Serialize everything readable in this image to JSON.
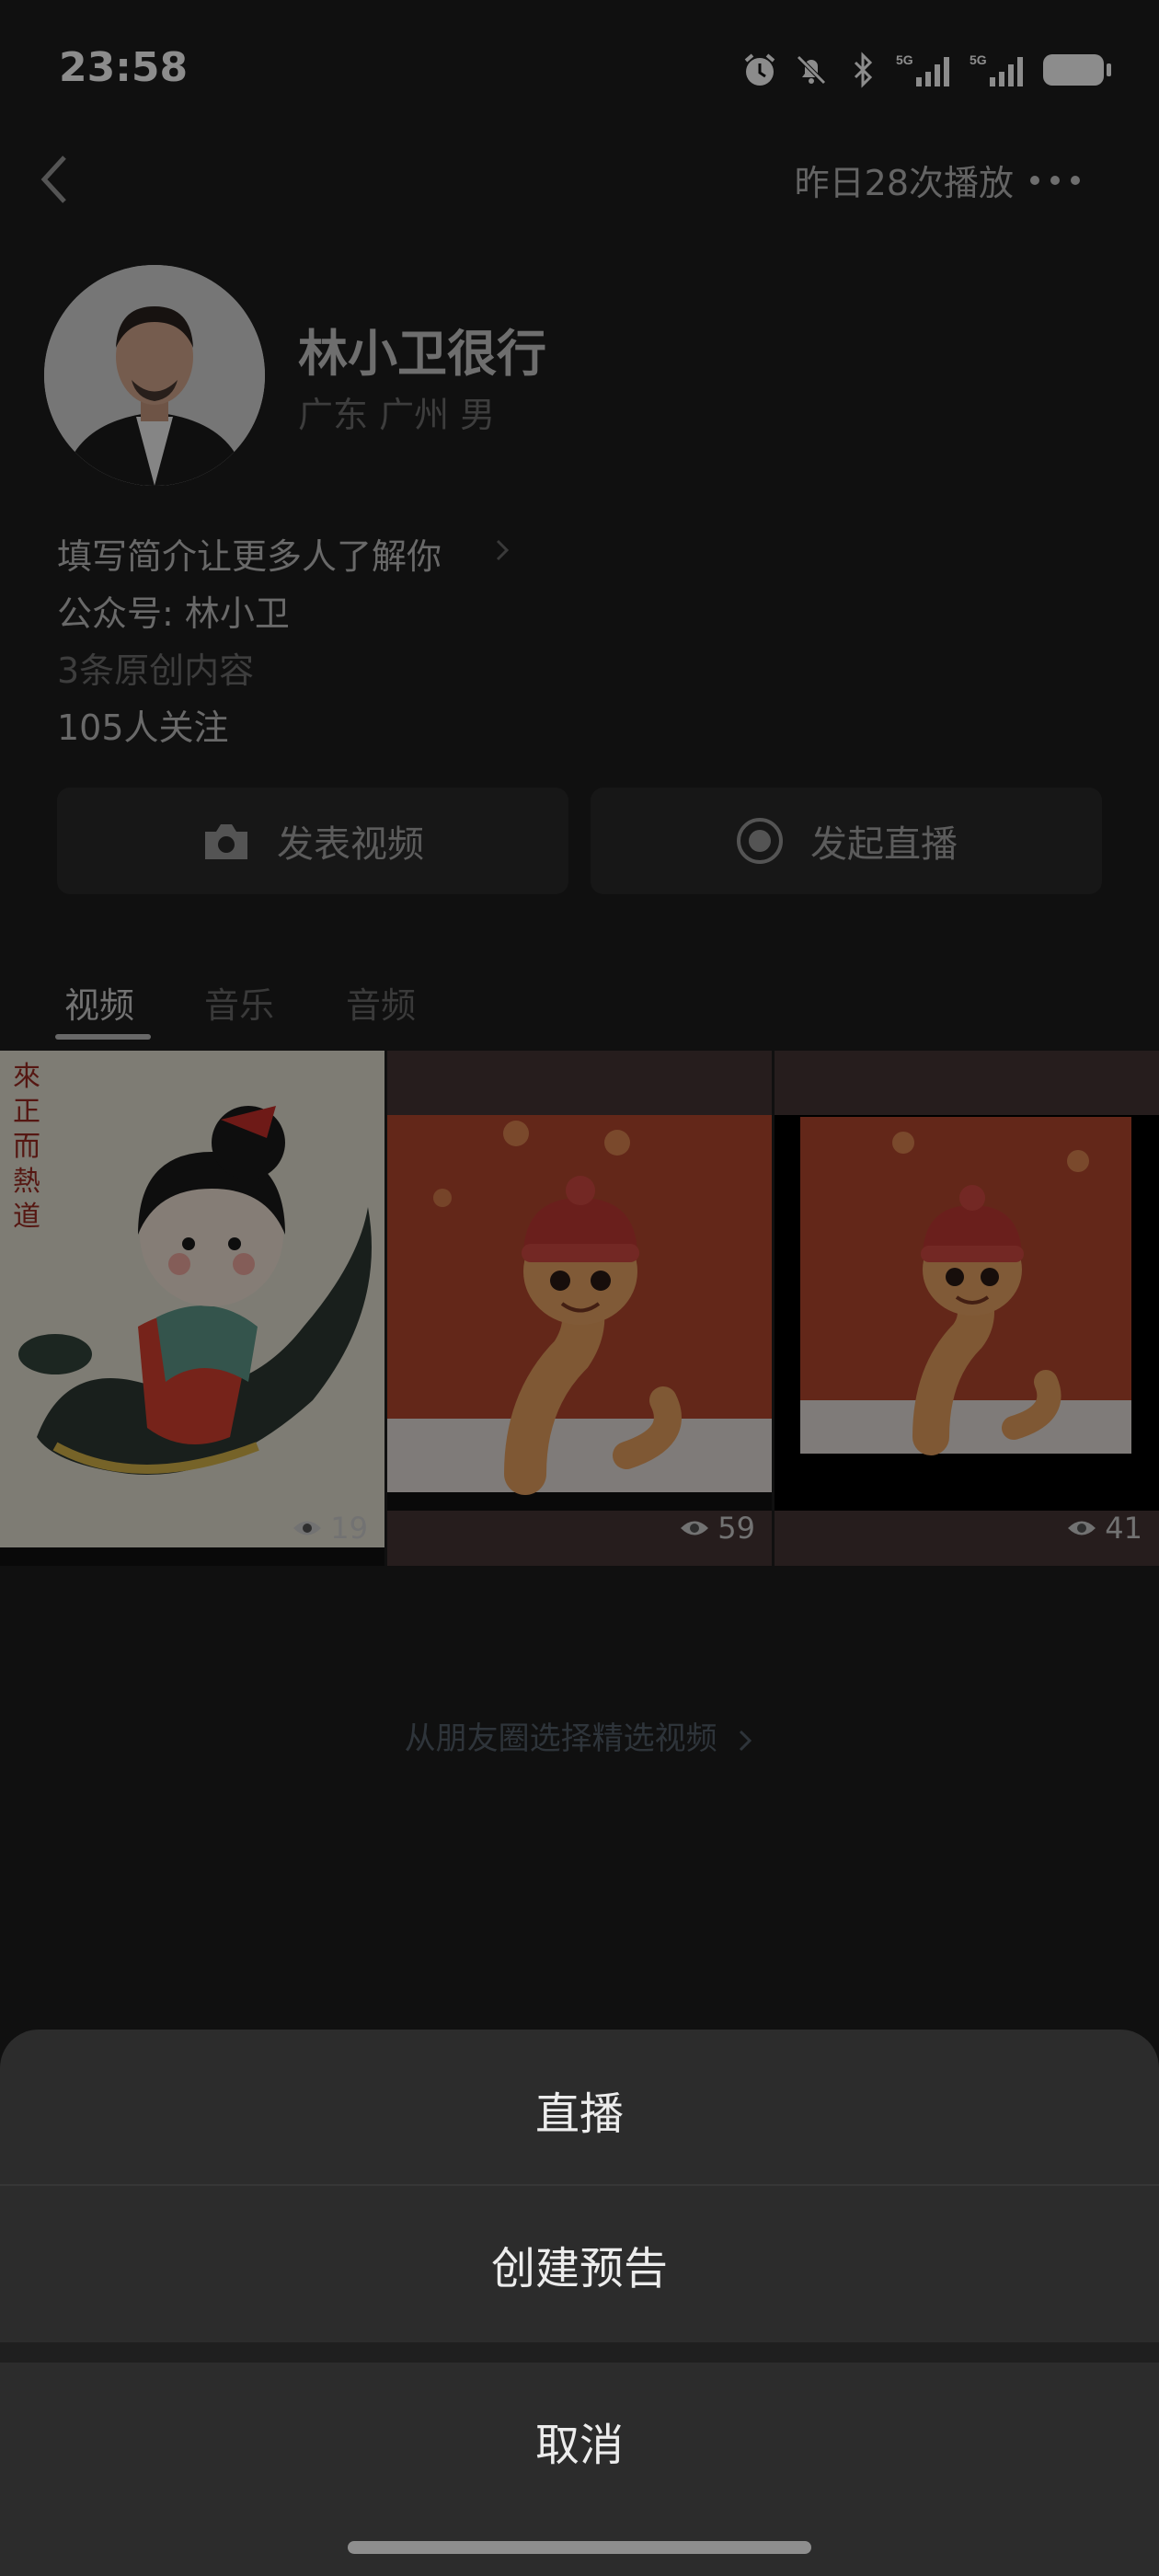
{
  "status_bar": {
    "time": "23:58",
    "icons": [
      "alarm-icon",
      "mute-icon",
      "bluetooth-icon",
      "signal-5g-icon",
      "signal-5g-icon",
      "battery-icon"
    ],
    "signal_label": "5G"
  },
  "header": {
    "plays_label": "昨日28次播放"
  },
  "profile": {
    "name": "林小卫很行",
    "location": "广东 广州 男",
    "bio_prompt": "填写简介让更多人了解你",
    "official_account": "公众号: 林小卫",
    "original_count": "3条原创内容",
    "followers": "105人关注"
  },
  "actions": {
    "post_video": "发表视频",
    "start_live": "发起直播"
  },
  "tabs": [
    {
      "label": "视频",
      "active": true
    },
    {
      "label": "音乐",
      "active": false
    },
    {
      "label": "音频",
      "active": false
    }
  ],
  "videos": [
    {
      "views": "19",
      "thumb_text": "來正而熱道"
    },
    {
      "views": "59"
    },
    {
      "views": "41"
    }
  ],
  "choose_moments": "从朋友圈选择精选视频",
  "sheet": {
    "live": "直播",
    "create_notice": "创建预告",
    "cancel": "取消"
  },
  "colors": {
    "background": "#1e1e1e",
    "sheet": "#2c2c2c",
    "accent_red": "#c8462f"
  }
}
